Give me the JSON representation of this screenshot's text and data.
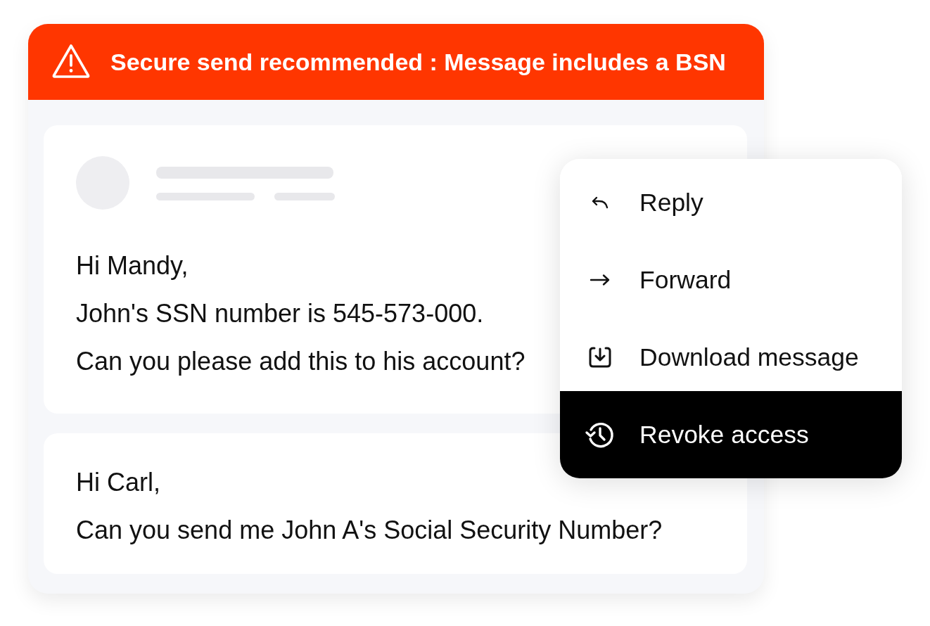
{
  "banner": {
    "text": "Secure send recommended : Message includes a BSN"
  },
  "messages": [
    {
      "sender_placeholder": true,
      "lines": [
        "Hi Mandy,",
        "John's SSN number is 545-573-000.",
        "Can you please add this to his account?"
      ]
    },
    {
      "sender_placeholder": false,
      "lines": [
        "Hi Carl,",
        "Can you send me John A's Social Security Number?"
      ]
    }
  ],
  "menu": {
    "items": [
      {
        "label": "Reply",
        "selected": false
      },
      {
        "label": "Forward",
        "selected": false
      },
      {
        "label": "Download message",
        "selected": false
      },
      {
        "label": "Revoke access",
        "selected": true
      }
    ]
  }
}
